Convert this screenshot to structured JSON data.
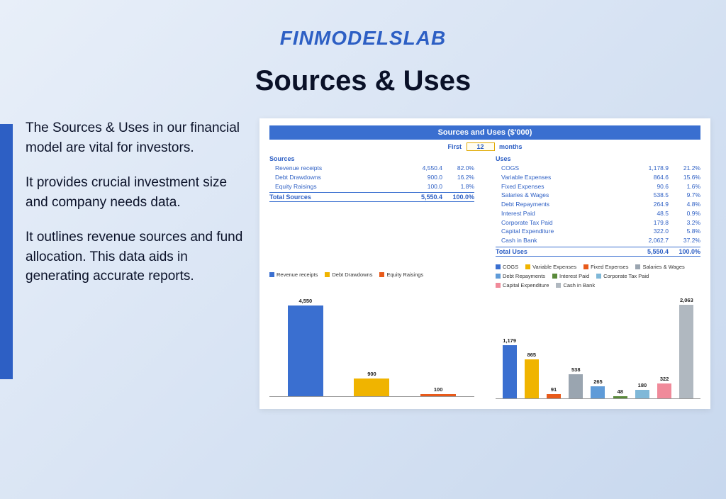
{
  "logo": "FINMODELSLAB",
  "title": "Sources & Uses",
  "paragraphs": [
    "The Sources & Uses in our financial model are vital for investors.",
    "It provides crucial investment size and company needs data.",
    "It outlines revenue sources and fund allocation. This data aids in generating accurate reports."
  ],
  "panel": {
    "title": "Sources and Uses ($'000)",
    "period": {
      "prefix": "First",
      "value": "12",
      "suffix": "months"
    },
    "sources": {
      "header": "Sources",
      "rows": [
        {
          "label": "Revenue receipts",
          "value": "4,550.4",
          "pct": "82.0%"
        },
        {
          "label": "Debt Drawdowns",
          "value": "900.0",
          "pct": "16.2%"
        },
        {
          "label": "Equity Raisings",
          "value": "100.0",
          "pct": "1.8%"
        }
      ],
      "total": {
        "label": "Total Sources",
        "value": "5,550.4",
        "pct": "100.0%"
      }
    },
    "uses": {
      "header": "Uses",
      "rows": [
        {
          "label": "COGS",
          "value": "1,178.9",
          "pct": "21.2%"
        },
        {
          "label": "Variable Expenses",
          "value": "864.6",
          "pct": "15.6%"
        },
        {
          "label": "Fixed Expenses",
          "value": "90.6",
          "pct": "1.6%"
        },
        {
          "label": "Salaries & Wages",
          "value": "538.5",
          "pct": "9.7%"
        },
        {
          "label": "Debt Repayments",
          "value": "264.9",
          "pct": "4.8%"
        },
        {
          "label": "Interest Paid",
          "value": "48.5",
          "pct": "0.9%"
        },
        {
          "label": "Corporate Tax Paid",
          "value": "179.8",
          "pct": "3.2%"
        },
        {
          "label": "Capital Expenditure",
          "value": "322.0",
          "pct": "5.8%"
        },
        {
          "label": "Cash in Bank",
          "value": "2,062.7",
          "pct": "37.2%"
        }
      ],
      "total": {
        "label": "Total Uses",
        "value": "5,550.4",
        "pct": "100.0%"
      }
    }
  },
  "chart_data": [
    {
      "type": "bar",
      "title": "Sources",
      "categories": [
        "Revenue receipts",
        "Debt Drawdowns",
        "Equity Raisings"
      ],
      "values": [
        4550,
        900,
        100
      ],
      "value_labels": [
        "4,550",
        "900",
        "100"
      ],
      "colors": [
        "#3a6fd0",
        "#f0b400",
        "#e85a1a"
      ],
      "ylim": [
        0,
        5000
      ]
    },
    {
      "type": "bar",
      "title": "Uses",
      "categories": [
        "COGS",
        "Variable Expenses",
        "Fixed Expenses",
        "Salaries & Wages",
        "Debt Repayments",
        "Interest Paid",
        "Corporate Tax Paid",
        "Capital Expenditure",
        "Cash in Bank"
      ],
      "values": [
        1179,
        865,
        91,
        538,
        265,
        48,
        180,
        322,
        2063
      ],
      "value_labels": [
        "1,179",
        "865",
        "91",
        "538",
        "265",
        "48",
        "180",
        "322",
        "2,063"
      ],
      "colors": [
        "#3a6fd0",
        "#f0b400",
        "#e85a1a",
        "#9aa5b0",
        "#5f9bd8",
        "#5a8a3a",
        "#7fb8d8",
        "#f08a9a",
        "#b0b8c0"
      ],
      "ylim": [
        0,
        2200
      ]
    }
  ]
}
